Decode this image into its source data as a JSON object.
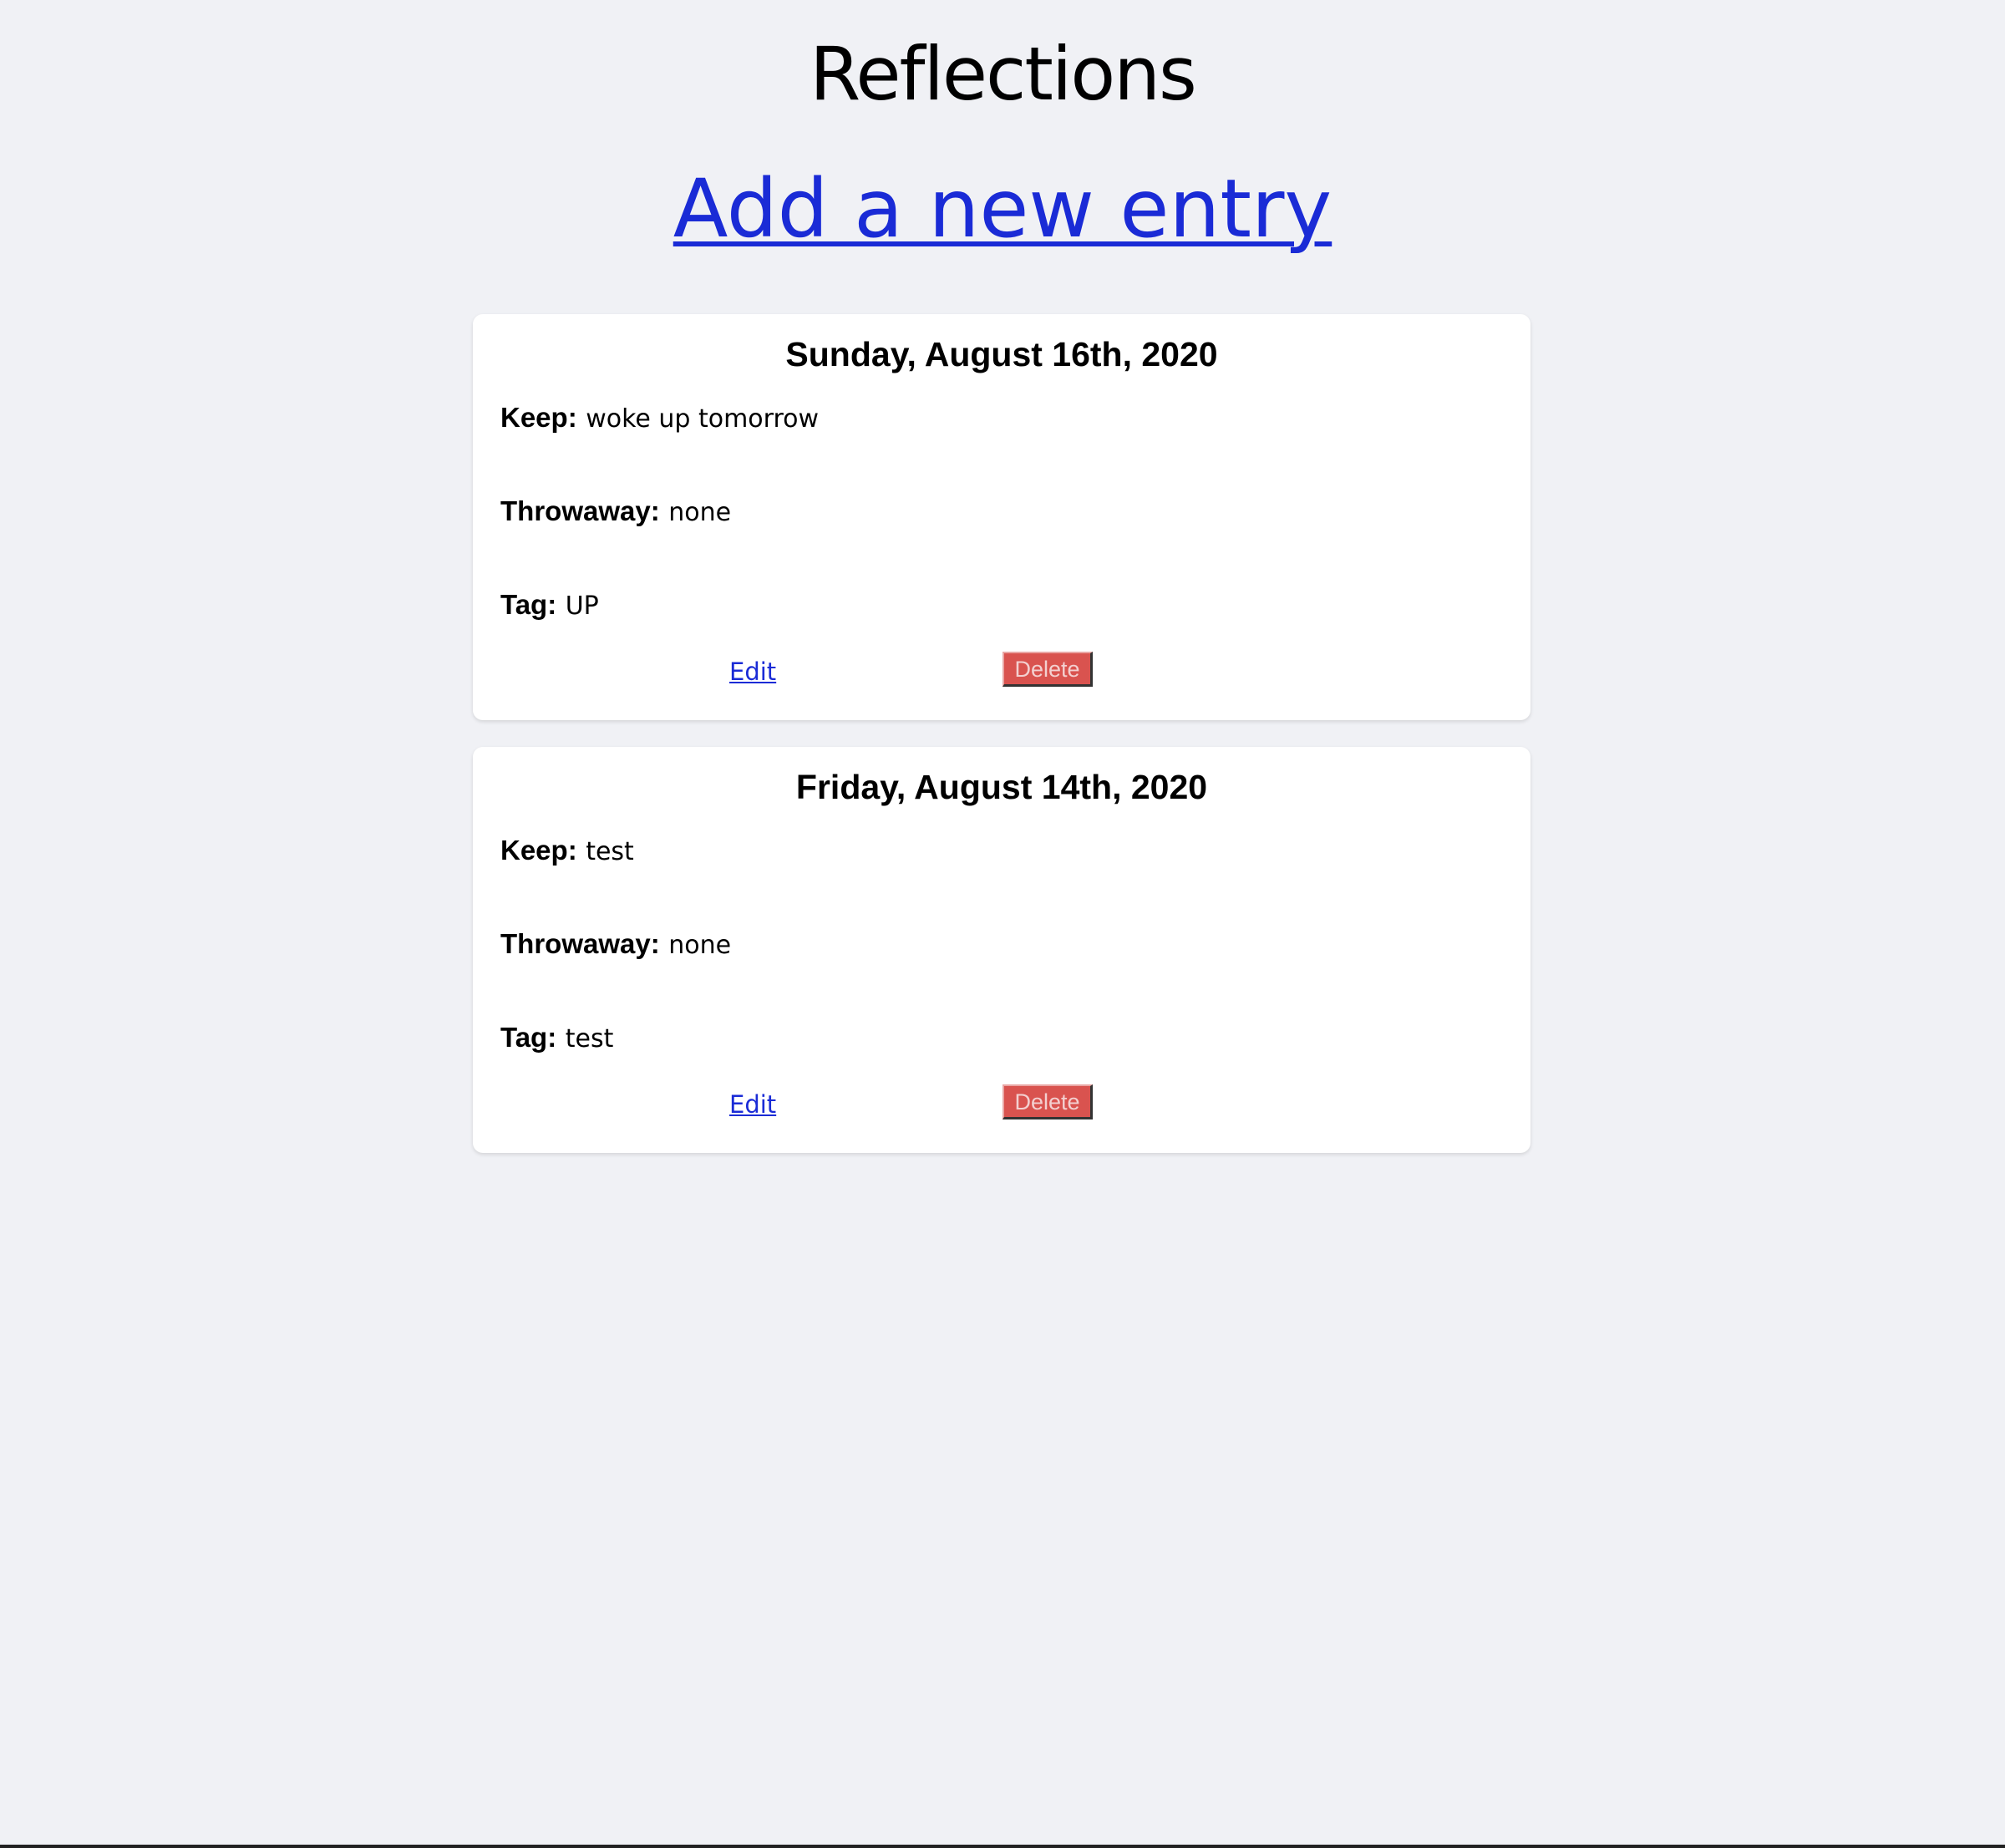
{
  "header": {
    "title": "Reflections",
    "new_entry_link": "Add a new entry"
  },
  "entries": [
    {
      "date": "Sunday, August 16th, 2020",
      "keep_label": "Keep:",
      "keep_value": "woke up tomorrow",
      "throwaway_label": "Throwaway:",
      "throwaway_value": "none",
      "tag_label": "Tag:",
      "tag_value": "UP",
      "edit_label": "Edit",
      "delete_label": "Delete"
    },
    {
      "date": "Friday, August 14th, 2020",
      "keep_label": "Keep:",
      "keep_value": "test",
      "throwaway_label": "Throwaway:",
      "throwaway_value": "none",
      "tag_label": "Tag:",
      "tag_value": "test",
      "edit_label": "Edit",
      "delete_label": "Delete"
    }
  ],
  "colors": {
    "background": "#f0f1f5",
    "link": "#1a2bd6",
    "delete_button": "#d9534f",
    "card": "#ffffff"
  }
}
